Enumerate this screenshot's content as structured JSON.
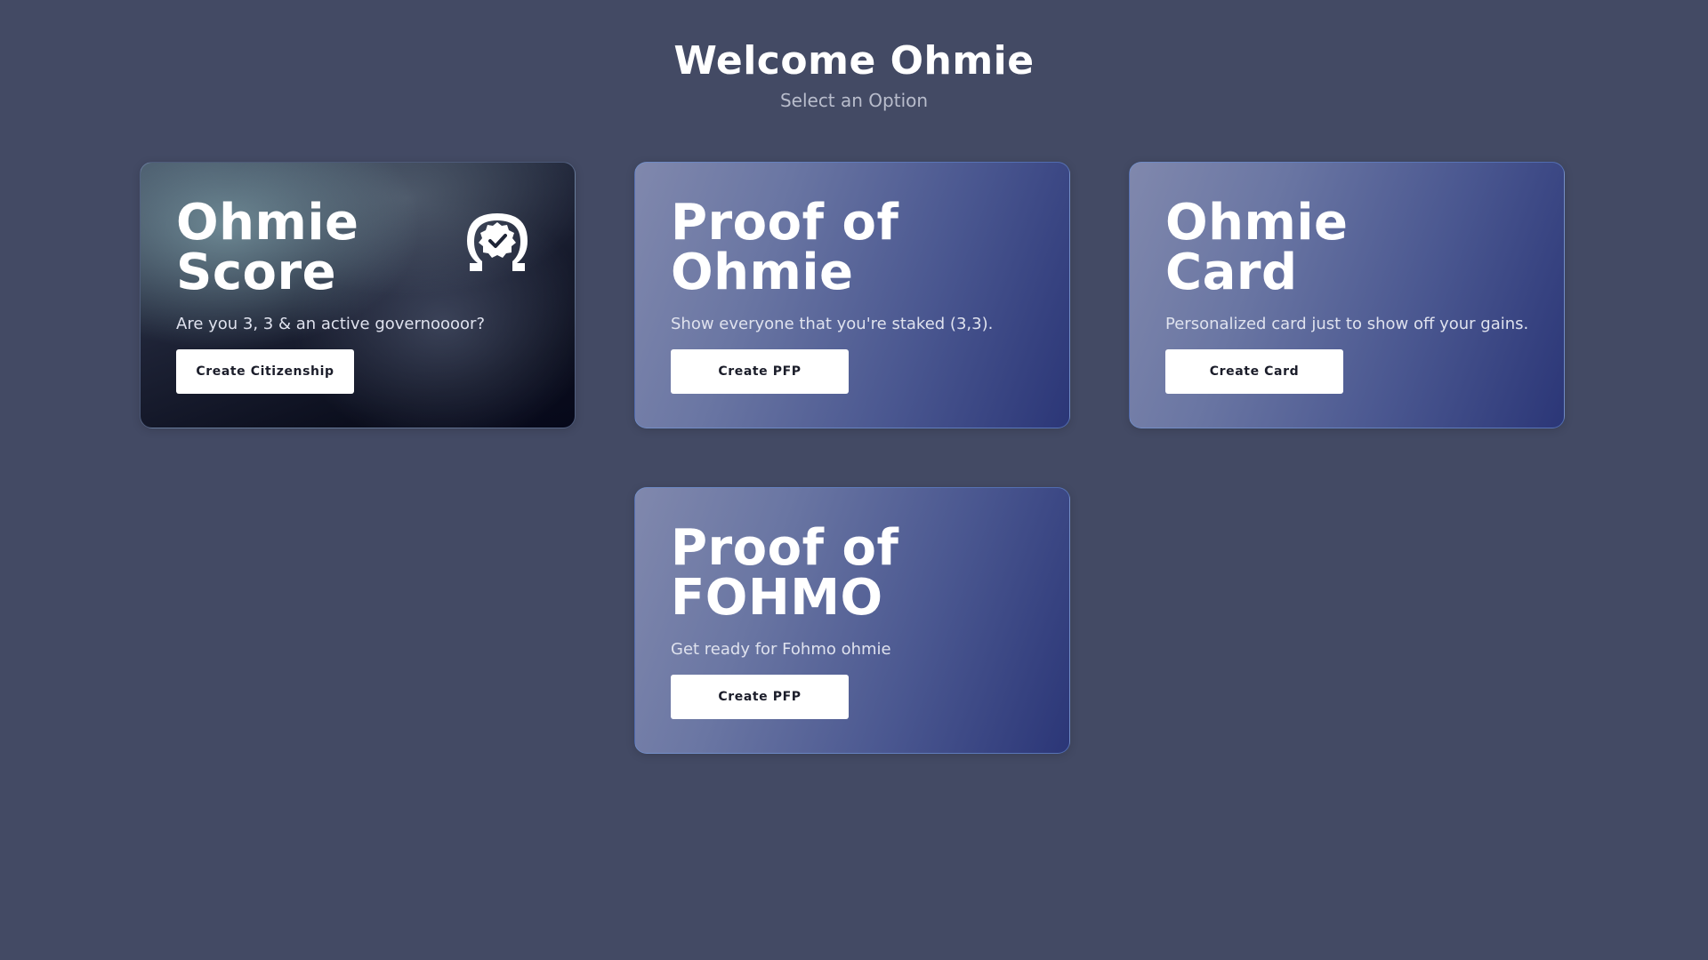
{
  "header": {
    "title": "Welcome Ohmie",
    "subtitle": "Select an Option"
  },
  "cards": [
    {
      "title": "Ohmie\nScore",
      "description": "Are you 3, 3 & an active governoooor?",
      "button_label": "Create Citizenship",
      "icon": "omega-badge-check-icon",
      "style": "dark"
    },
    {
      "title": "Proof of\nOhmie",
      "description": "Show everyone that you're staked (3,3).",
      "button_label": "Create PFP",
      "style": "gradient"
    },
    {
      "title": "Ohmie\nCard",
      "description": "Personalized card just to show off your gains.",
      "button_label": "Create Card",
      "style": "gradient"
    },
    {
      "title": "Proof of\nFOHMO",
      "description": "Get ready for Fohmo ohmie",
      "button_label": "Create PFP",
      "style": "gradient"
    }
  ],
  "colors": {
    "background": "#434a64",
    "card_gradient_start": "#8088ad",
    "card_gradient_end": "#2b3677",
    "button_bg": "#ffffff",
    "button_text": "#1b1d2a"
  }
}
